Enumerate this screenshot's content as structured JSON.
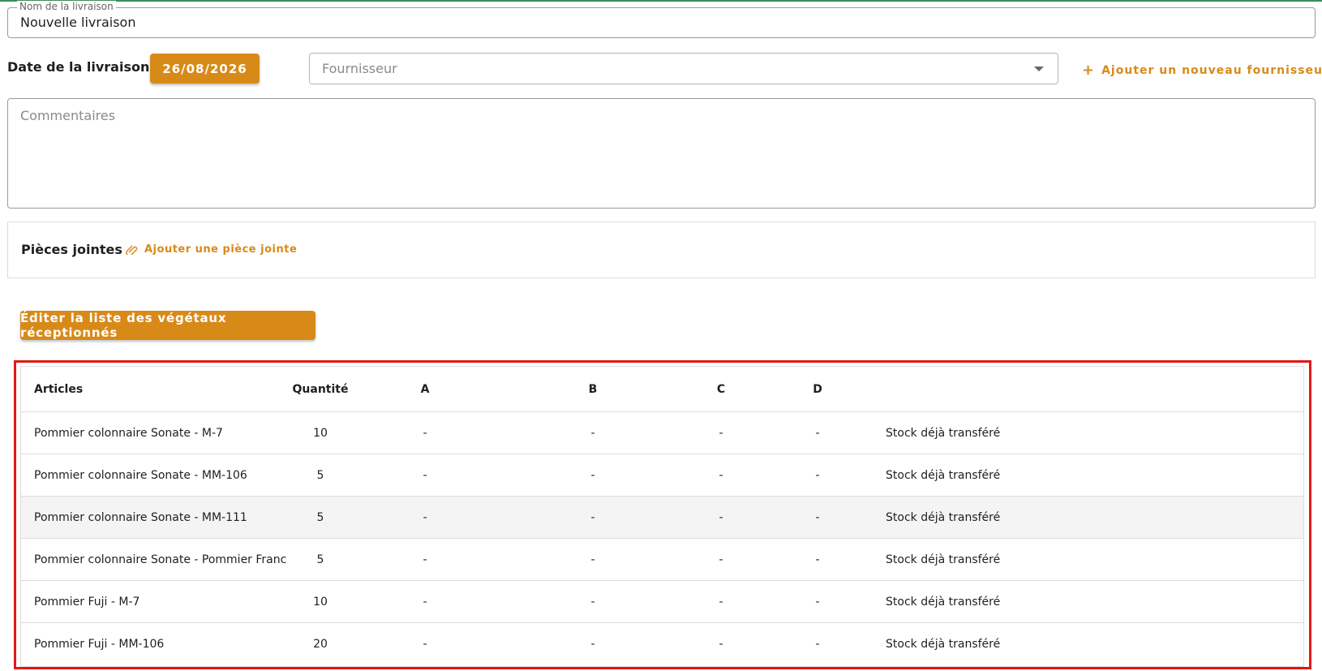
{
  "form": {
    "name_label": "Nom de la livraison",
    "name_value": "Nouvelle livraison",
    "date_label": "Date de la livraison:",
    "date_value": "26/08/2026",
    "supplier_placeholder": "Fournisseur",
    "add_supplier_label": "Ajouter un nouveau fournisseur",
    "comments_placeholder": "Commentaires"
  },
  "attachments": {
    "title": "Pièces jointes",
    "add_label": "Ajouter une pièce jointe"
  },
  "edit_button_label": "Éditer la liste des végétaux réceptionnés",
  "table": {
    "headers": {
      "articles": "Articles",
      "quantity": "Quantité",
      "a": "A",
      "b": "B",
      "c": "C",
      "d": "D"
    },
    "rows": [
      {
        "article": "Pommier colonnaire Sonate - M-7",
        "quantity": "10",
        "a": "-",
        "b": "-",
        "c": "-",
        "d": "-",
        "status": "Stock déjà transféré"
      },
      {
        "article": "Pommier colonnaire Sonate - MM-106",
        "quantity": "5",
        "a": "-",
        "b": "-",
        "c": "-",
        "d": "-",
        "status": "Stock déjà transféré"
      },
      {
        "article": "Pommier colonnaire Sonate - MM-111",
        "quantity": "5",
        "a": "-",
        "b": "-",
        "c": "-",
        "d": "-",
        "status": "Stock déjà transféré"
      },
      {
        "article": "Pommier colonnaire Sonate - Pommier Franc",
        "quantity": "5",
        "a": "-",
        "b": "-",
        "c": "-",
        "d": "-",
        "status": "Stock déjà transféré"
      },
      {
        "article": "Pommier Fuji - M-7",
        "quantity": "10",
        "a": "-",
        "b": "-",
        "c": "-",
        "d": "-",
        "status": "Stock déjà transféré"
      },
      {
        "article": "Pommier Fuji - MM-106",
        "quantity": "20",
        "a": "-",
        "b": "-",
        "c": "-",
        "d": "-",
        "status": "Stock déjà transféré"
      }
    ]
  },
  "colors": {
    "accent": "#d88a19",
    "highlight_border": "#e01818",
    "top_line": "#3a8f5a"
  },
  "icons": {
    "plus": "plus-icon",
    "attach": "paperclip-icon",
    "dropdown": "chevron-down-icon"
  }
}
